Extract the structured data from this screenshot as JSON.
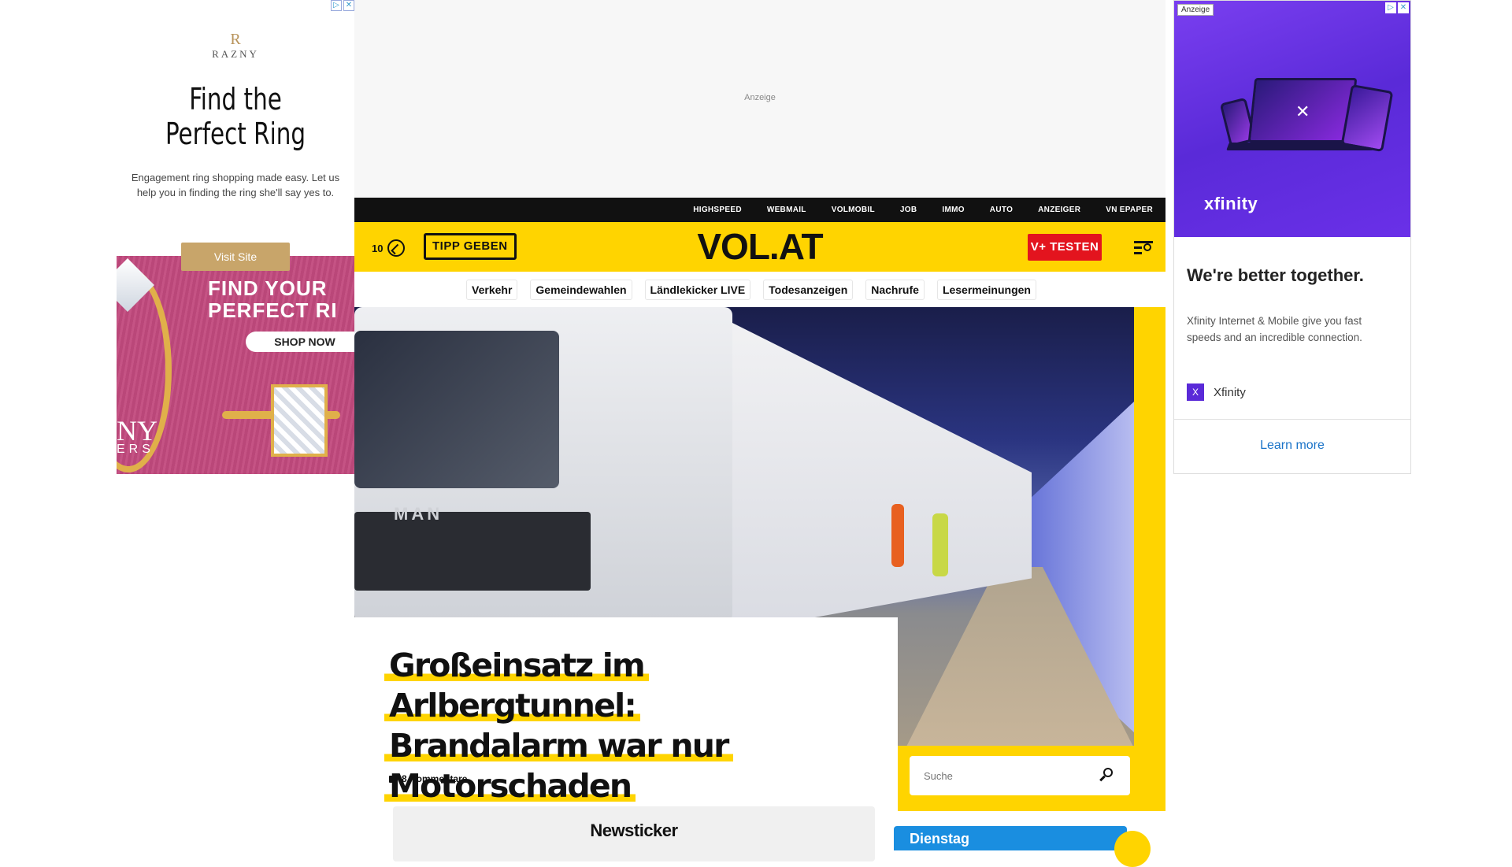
{
  "left_ad": {
    "brand_monogram": "R",
    "brand_name": "RAZNY",
    "headline": "Find the Perfect Ring",
    "description": "Engagement ring shopping made easy. Let us help you in finding the ring she'll say yes to.",
    "visit_button": "Visit Site",
    "banner_text": "FIND YOUR PERFECT RI",
    "shop_button": "SHOP NOW",
    "corner_text_1": "NY",
    "corner_text_2": "ERS",
    "adchoices_icons": [
      "adchoices-icon",
      "close-icon"
    ],
    "accent_color": "#c24a7e"
  },
  "right_ad": {
    "tag": "Anzeige",
    "brand_on_image": "xfinity",
    "tagline": "We're better together.",
    "body": "Xfinity Internet & Mobile give you fast speeds and an incredible connection.",
    "advertiser_initial": "X",
    "advertiser": "Xfinity",
    "cta": "Learn more",
    "hero_color": "#6a30e8",
    "cta_color": "#1a73c8"
  },
  "top_ad": {
    "label": "Anzeige"
  },
  "utility_nav": [
    "HIGHSPEED",
    "WEBMAIL",
    "VOLMOBIL",
    "JOB",
    "IMMO",
    "AUTO",
    "ANZEIGER",
    "VN EPAPER"
  ],
  "header": {
    "weather_value": "10",
    "tipp_button": "TIPP GEBEN",
    "logo": "VOL.AT",
    "vplus_button": "V+ TESTEN",
    "menu_icon": "menu-search-icon",
    "brand_yellow": "#ffd400",
    "vplus_red": "#e3141e"
  },
  "quicknav": [
    "Verkehr",
    "Gemeindewahlen",
    "Ländlekicker LIVE",
    "Todesanzeigen",
    "Nachrufe",
    "Lesermeinungen"
  ],
  "article": {
    "title_lines": [
      "Großeinsatz im Arlbergtunnel:",
      "Brandalarm war nur",
      "Motorschaden"
    ],
    "comments": "8 Kommentare",
    "newsticker": "Newsticker",
    "truck_brand": "MAN"
  },
  "sidebar": {
    "search_placeholder": "Suche",
    "day_label": "Dienstag",
    "day_box_color": "#1a8ee0"
  }
}
